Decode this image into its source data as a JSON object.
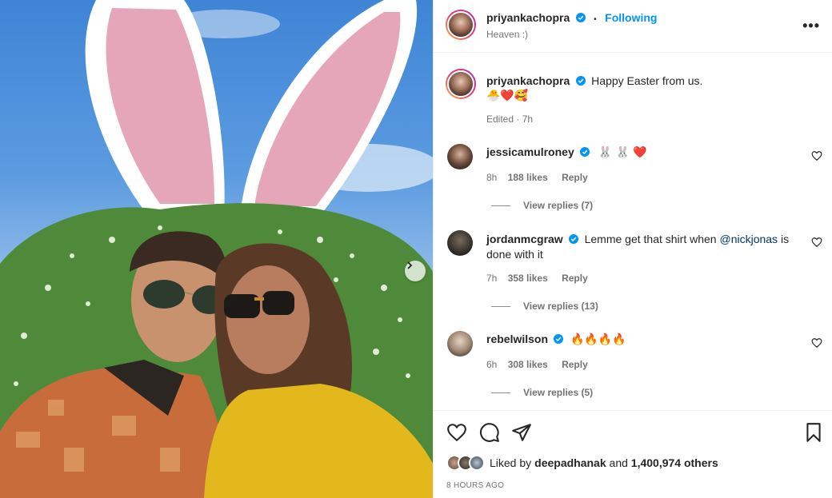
{
  "header": {
    "username": "priyankachopra",
    "dot": "•",
    "follow_label": "Following",
    "location": "Heaven :)",
    "more": "•••"
  },
  "caption": {
    "username": "priyankachopra",
    "text": "Happy Easter from us.",
    "emojis": "🐣❤️🥰",
    "edited": "Edited · 7h"
  },
  "comments": [
    {
      "username": "jessicamulroney",
      "text": "🐰 🐰 ❤️",
      "age": "8h",
      "likes": "188 likes",
      "reply": "Reply",
      "view_replies": "View replies (7)"
    },
    {
      "username": "jordanmcgraw",
      "text_before": "Lemme get that shirt when ",
      "mention": "@nickjonas",
      "text_after": " is done with it",
      "age": "7h",
      "likes": "358 likes",
      "reply": "Reply",
      "view_replies": "View replies (13)"
    },
    {
      "username": "rebelwilson",
      "text": "🔥🔥🔥🔥",
      "age": "6h",
      "likes": "308 likes",
      "reply": "Reply",
      "view_replies": "View replies (5)"
    }
  ],
  "likes": {
    "prefix": "Liked by ",
    "user": "deepadhanak",
    "middle": " and ",
    "count": "1,400,974 others"
  },
  "timestamp": "8 HOURS AGO",
  "colors": {
    "link_blue": "#0095f6",
    "verified_blue": "#0095f6",
    "heart_red": "#ed4956"
  },
  "icons": [
    "heart-icon",
    "comment-icon",
    "share-icon",
    "bookmark-icon",
    "verified-badge-icon",
    "more-options-icon",
    "next-arrow-icon"
  ]
}
